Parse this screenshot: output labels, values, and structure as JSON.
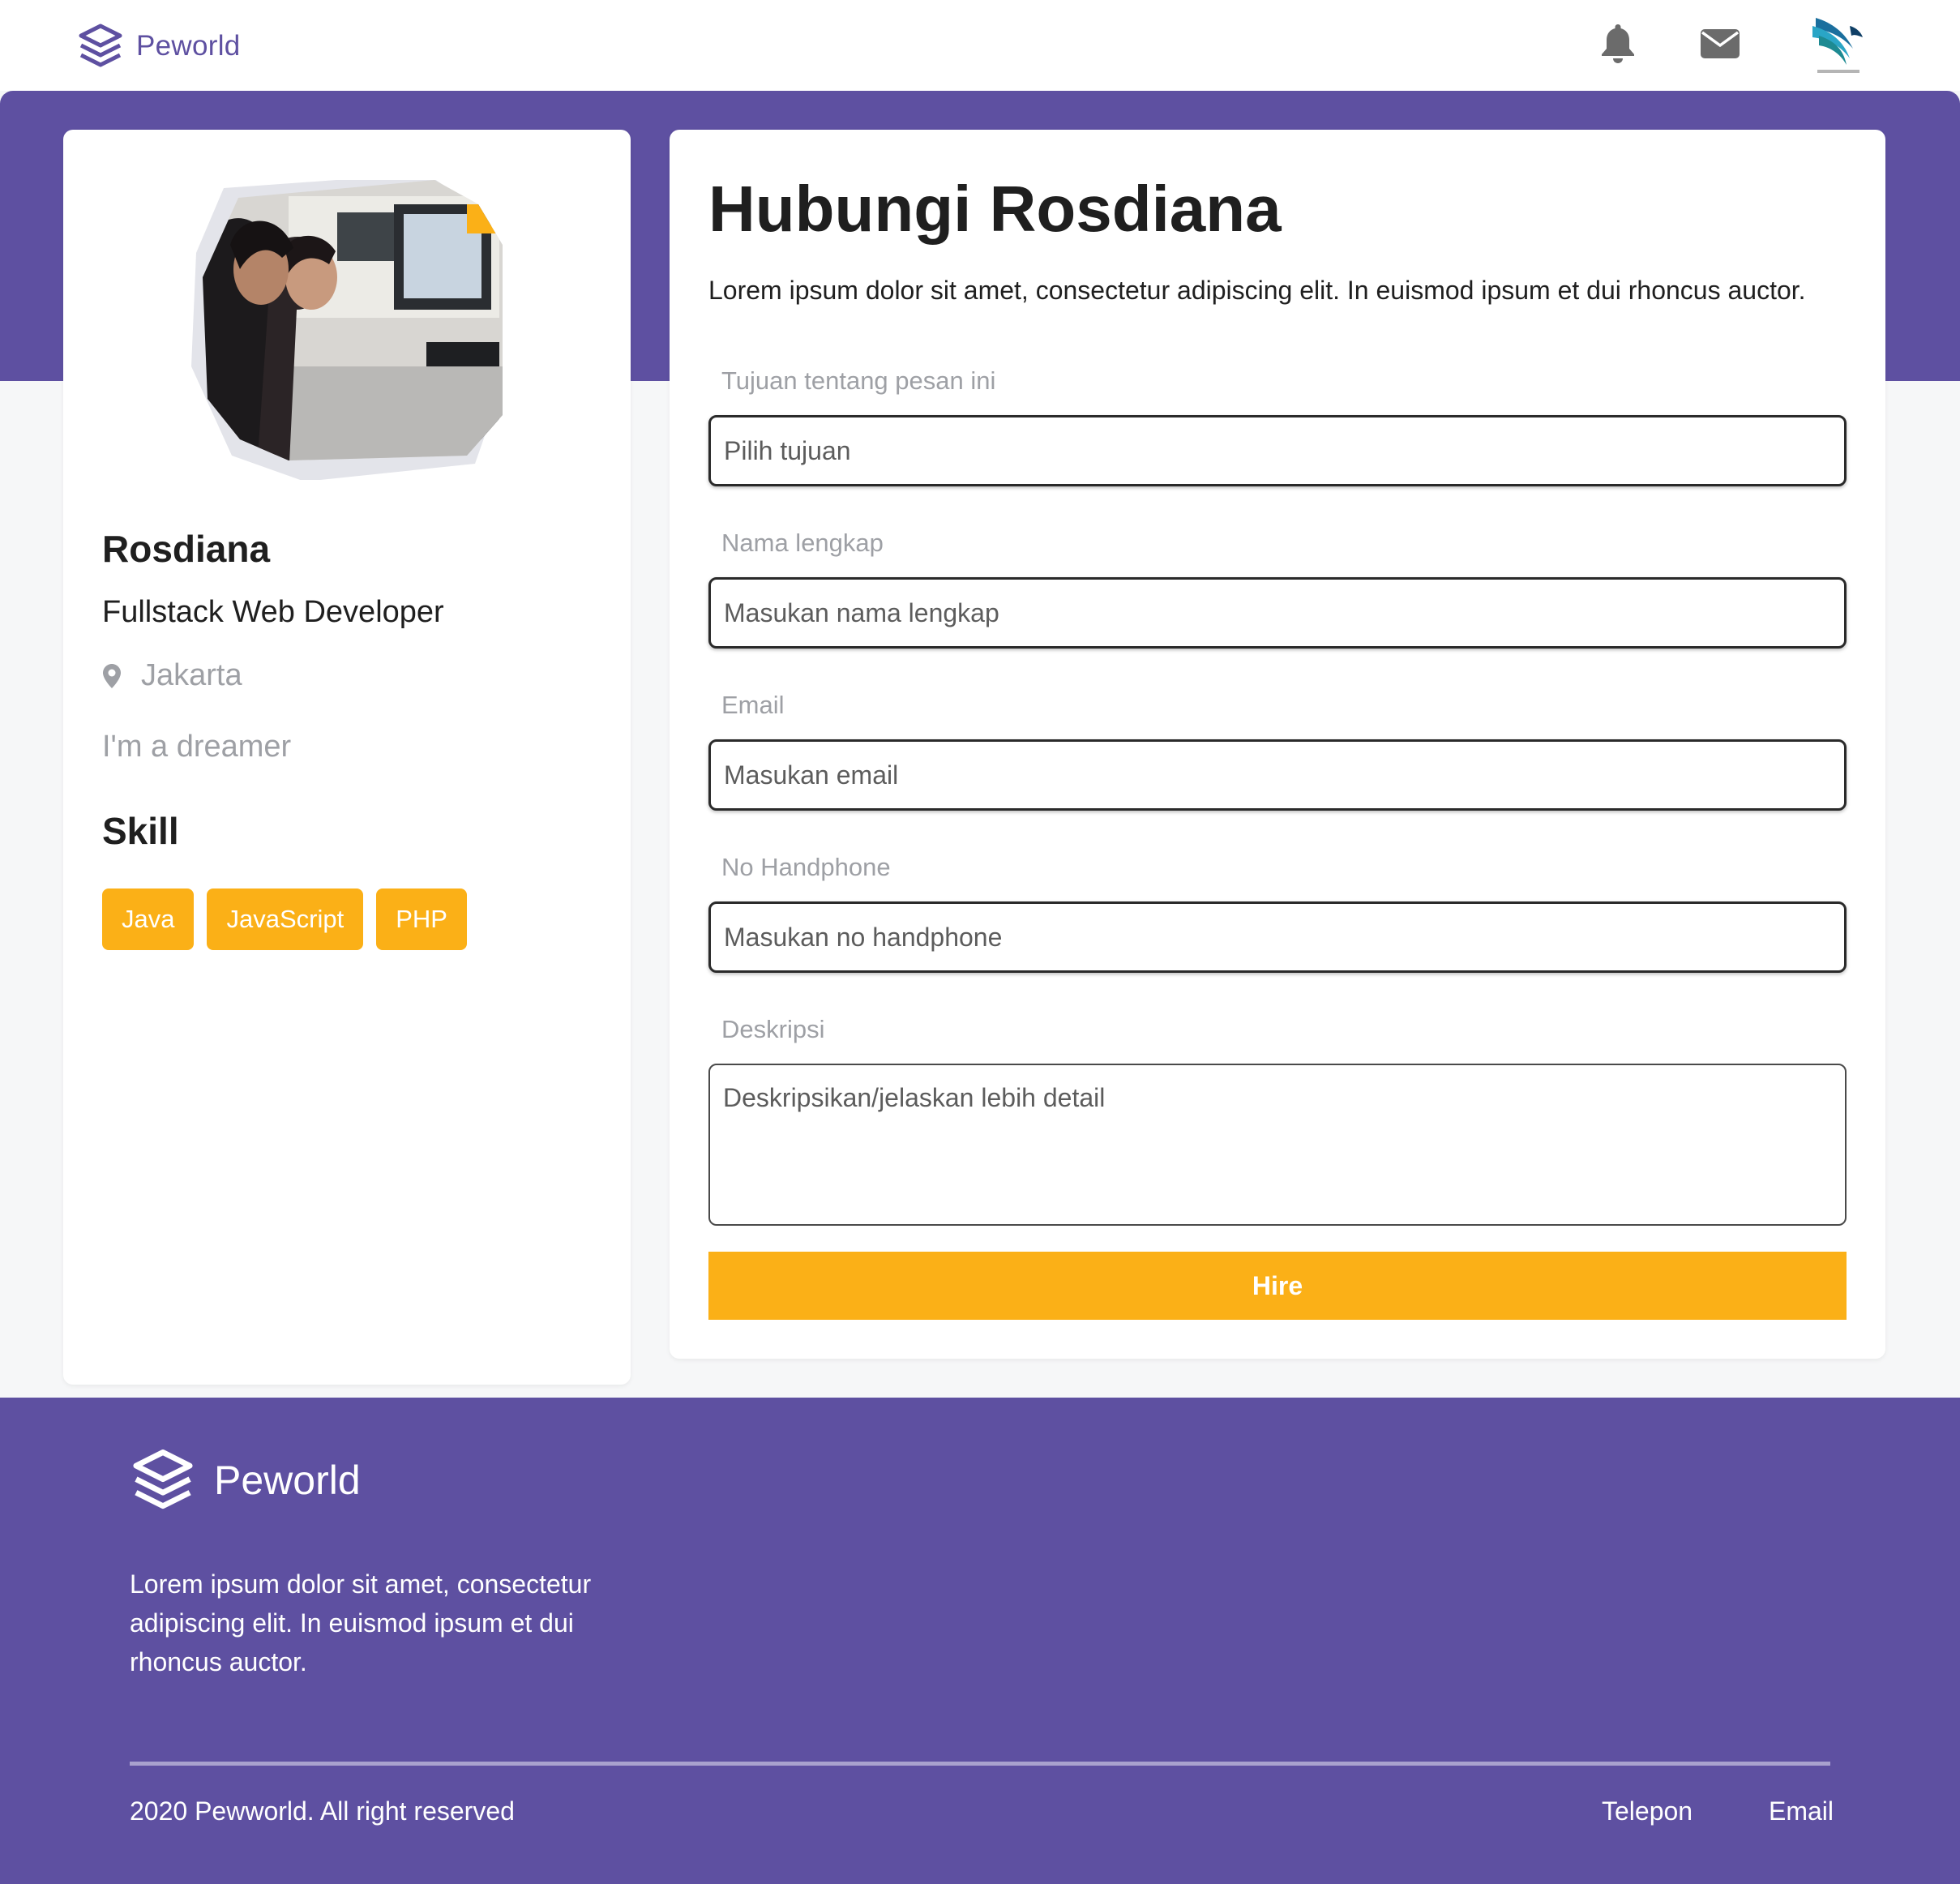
{
  "navbar": {
    "brand": "Peworld",
    "icons": [
      "bell-icon",
      "mail-icon"
    ],
    "avatar": "company-logo-avatar"
  },
  "profile": {
    "name": "Rosdiana",
    "job": "Fullstack Web Developer",
    "location": "Jakarta",
    "bio": "I'm a dreamer",
    "skill_title": "Skill",
    "skills": [
      "Java",
      "JavaScript",
      "PHP"
    ]
  },
  "contact": {
    "title": "Hubungi Rosdiana",
    "description": "Lorem ipsum dolor sit amet, consectetur adipiscing elit. In euismod ipsum et dui rhoncus auctor.",
    "fields": [
      {
        "label": "Tujuan tentang pesan ini",
        "placeholder": "Pilih tujuan",
        "value": ""
      },
      {
        "label": "Nama lengkap",
        "placeholder": "Masukan nama lengkap",
        "value": ""
      },
      {
        "label": "Email",
        "placeholder": "Masukan email",
        "value": ""
      },
      {
        "label": "No Handphone",
        "placeholder": "Masukan no handphone",
        "value": ""
      }
    ],
    "description_field": {
      "label": "Deskripsi",
      "placeholder": "Deskripsikan/jelaskan lebih detail",
      "value": ""
    },
    "submit_label": "Hire"
  },
  "footer": {
    "brand": "Peworld",
    "description": "Lorem ipsum dolor sit amet, consectetur adipiscing elit. In euismod ipsum et dui rhoncus auctor.",
    "copyright": "2020 Pewworld. All right reserved",
    "links": [
      "Telepon",
      "Email"
    ]
  },
  "colors": {
    "primary": "#5e50a1",
    "accent": "#fbb017",
    "muted_text": "#9ea0a5",
    "page_bg": "#f6f7f8"
  }
}
